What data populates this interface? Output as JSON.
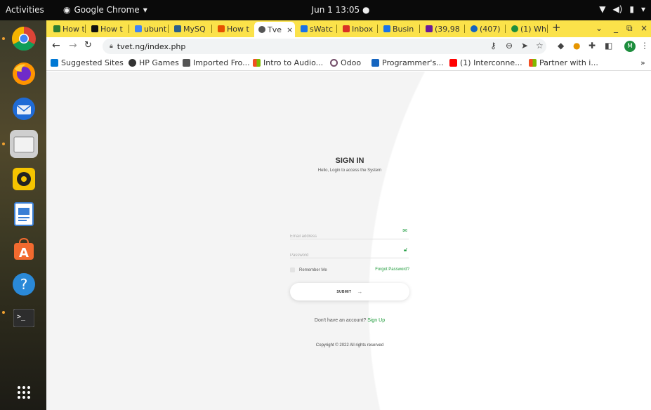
{
  "topbar": {
    "activities": "Activities",
    "app_name": "Google Chrome",
    "clock": "Jun 1  13:05"
  },
  "dock": {
    "items": [
      {
        "name": "chrome-icon"
      },
      {
        "name": "firefox-icon"
      },
      {
        "name": "thunderbird-icon"
      },
      {
        "name": "files-icon"
      },
      {
        "name": "rhythmbox-icon"
      },
      {
        "name": "writer-icon"
      },
      {
        "name": "software-icon"
      },
      {
        "name": "help-icon"
      },
      {
        "name": "terminal-icon"
      },
      {
        "name": "apps-grid-icon"
      }
    ]
  },
  "tabs": [
    {
      "label": "How t",
      "color": "#2e7d32"
    },
    {
      "label": "How t",
      "color": "#111111"
    },
    {
      "label": "ubunt",
      "color": "#4285f4"
    },
    {
      "label": "MySQ",
      "color": "#2b5f8a"
    },
    {
      "label": "How t",
      "color": "#e65100"
    },
    {
      "label": "Tve",
      "color": "#555555",
      "active": true
    },
    {
      "label": "sWatc",
      "color": "#1a73e8"
    },
    {
      "label": "Inbox",
      "color": "#d93025"
    },
    {
      "label": "Busin",
      "color": "#1a73e8"
    },
    {
      "label": "(39,98",
      "color": "#6a1b9a"
    },
    {
      "label": "(407)",
      "color": "#1565c0"
    },
    {
      "label": "(1) Wh",
      "color": "#1e8e3e"
    }
  ],
  "toolbar": {
    "url": "tvet.ng/index.php",
    "avatar_letter": "M"
  },
  "bookmarks": [
    {
      "label": "Suggested Sites",
      "color": "#0078d4"
    },
    {
      "label": "HP Games",
      "color": "#333333"
    },
    {
      "label": "Imported Fro...",
      "color": "#555555"
    },
    {
      "label": "Intro to Audio...",
      "color": "#f25022"
    },
    {
      "label": "Odoo",
      "color": "#714b67"
    },
    {
      "label": "Programmer's...",
      "color": "#1565c0"
    },
    {
      "label": "(1) Interconne...",
      "color": "#ff0000"
    },
    {
      "label": "Partner with i...",
      "color": "#f25022"
    }
  ],
  "page": {
    "title": "SIGN IN",
    "subtitle": "Hello, Login to access the System",
    "email_placeholder": "Email address",
    "password_placeholder": "Password",
    "remember_label": "Remember Me",
    "forgot_label": "Forgot Password?",
    "submit_label": "SUBMIT",
    "no_account_text": "Don't have an account?",
    "signup_label": "Sign Up",
    "copyright": "Copyright © 2022 All rights reserved",
    "accent_color": "#1e9a3a"
  }
}
